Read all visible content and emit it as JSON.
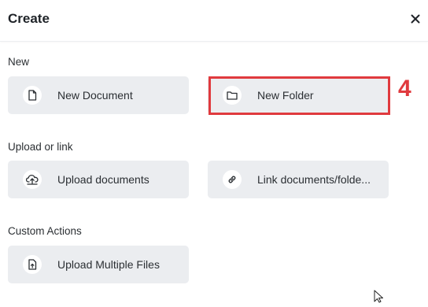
{
  "dialog": {
    "title": "Create",
    "close_icon": "close-icon"
  },
  "sections": {
    "new": {
      "label": "New",
      "new_document": {
        "label": "New Document",
        "icon": "document-icon"
      },
      "new_folder": {
        "label": "New Folder",
        "icon": "folder-icon"
      }
    },
    "upload": {
      "label": "Upload or link",
      "upload_documents": {
        "label": "Upload documents",
        "icon": "upload-cloud-icon"
      },
      "link_documents": {
        "label": "Link documents/folde...",
        "icon": "link-icon"
      }
    },
    "custom": {
      "label": "Custom Actions",
      "upload_multiple": {
        "label": "Upload Multiple Files",
        "icon": "file-upload-icon"
      }
    }
  },
  "annotation": {
    "step_number": "4",
    "color": "#e03a3e"
  }
}
